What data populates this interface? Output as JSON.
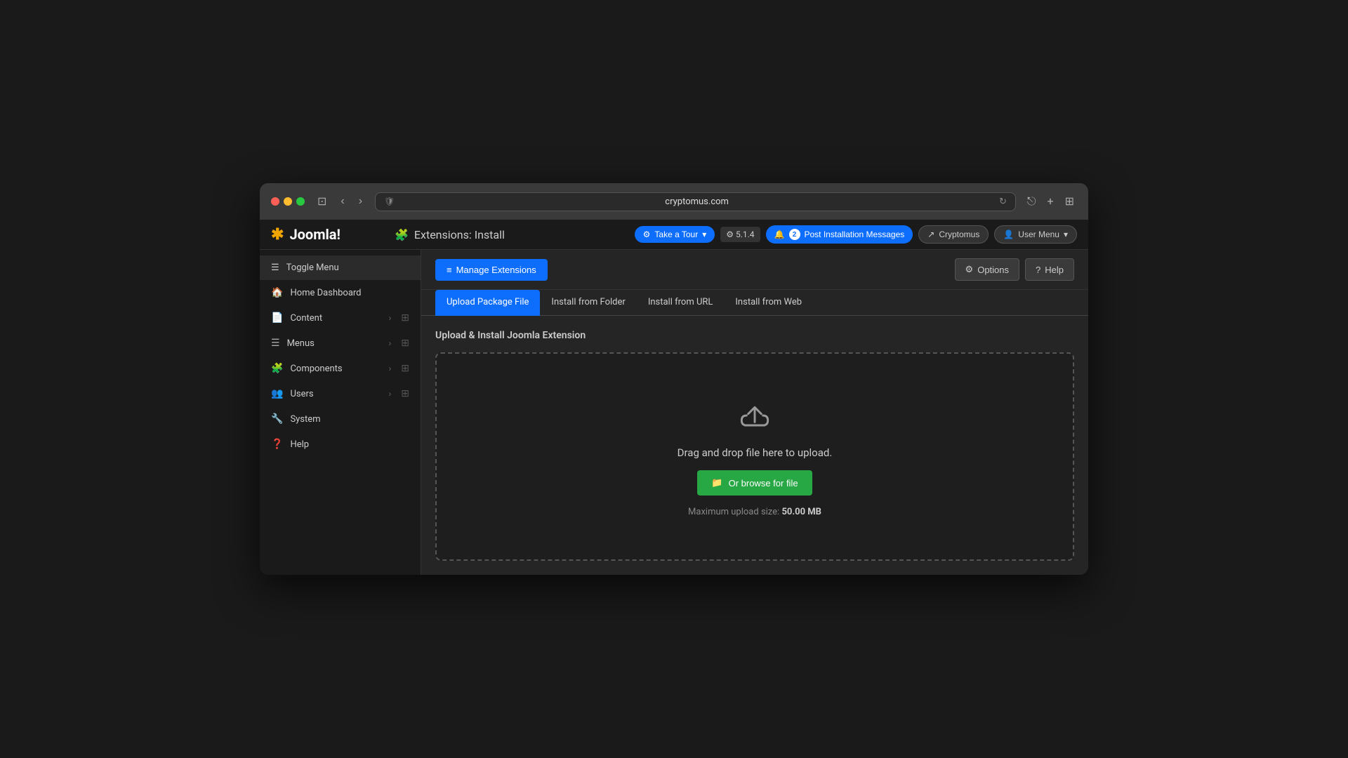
{
  "browser": {
    "url": "cryptomus.com",
    "shield_icon": "🛡"
  },
  "topbar": {
    "logo_text": "Joomla!",
    "page_title": "Extensions: Install",
    "tour_label": "Take a Tour",
    "version": "⚙ 5.1.4",
    "notifications_count": "2",
    "notifications_label": "Post Installation Messages",
    "cryptomus_label": "Cryptomus",
    "user_label": "User Menu"
  },
  "sidebar": {
    "toggle_label": "Toggle Menu",
    "items": [
      {
        "icon": "🏠",
        "label": "Home Dashboard",
        "hasArrow": false,
        "hasGrid": false
      },
      {
        "icon": "📄",
        "label": "Content",
        "hasArrow": true,
        "hasGrid": true
      },
      {
        "icon": "☰",
        "label": "Menus",
        "hasArrow": true,
        "hasGrid": true
      },
      {
        "icon": "🧩",
        "label": "Components",
        "hasArrow": true,
        "hasGrid": true
      },
      {
        "icon": "👥",
        "label": "Users",
        "hasArrow": true,
        "hasGrid": true
      },
      {
        "icon": "🔧",
        "label": "System",
        "hasArrow": false,
        "hasGrid": false
      },
      {
        "icon": "❓",
        "label": "Help",
        "hasArrow": false,
        "hasGrid": false
      }
    ]
  },
  "content": {
    "manage_button": "Manage Extensions",
    "options_button": "Options",
    "help_button": "Help",
    "tabs": [
      {
        "label": "Upload Package File",
        "active": true
      },
      {
        "label": "Install from Folder",
        "active": false
      },
      {
        "label": "Install from URL",
        "active": false
      },
      {
        "label": "Install from Web",
        "active": false
      }
    ],
    "panel_title": "Upload & Install Joomla Extension",
    "drop_zone": {
      "drag_text": "Drag and drop file here to upload.",
      "browse_button": "Or browse for file",
      "max_size_label": "Maximum upload size:",
      "max_size_value": "50.00 MB"
    }
  }
}
